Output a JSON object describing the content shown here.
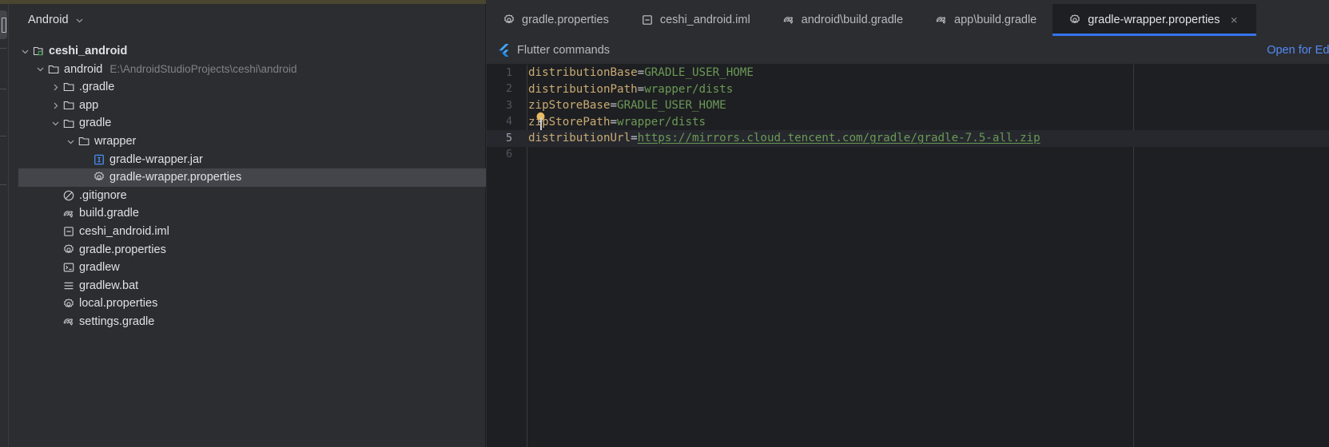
{
  "window": {
    "theme_accent": "#3574f0",
    "background": "#1e1f22",
    "panel_background": "#2b2d30"
  },
  "left_rail": {
    "button_icon": "tool-window-icon"
  },
  "project_panel": {
    "title": "Android",
    "chevron_icon": "chevron-down-icon",
    "tree": [
      {
        "label": "ceshi_android",
        "sub": "",
        "indent": 0,
        "twisty": "expanded",
        "icon": "module-icon",
        "selected": false,
        "bold": true
      },
      {
        "label": "android",
        "sub": "E:\\AndroidStudioProjects\\ceshi\\android",
        "indent": 1,
        "twisty": "expanded",
        "icon": "folder-icon",
        "selected": false,
        "bold": false
      },
      {
        "label": ".gradle",
        "sub": "",
        "indent": 2,
        "twisty": "collapsed",
        "icon": "folder-icon",
        "selected": false,
        "bold": false
      },
      {
        "label": "app",
        "sub": "",
        "indent": 2,
        "twisty": "collapsed",
        "icon": "folder-icon",
        "selected": false,
        "bold": false
      },
      {
        "label": "gradle",
        "sub": "",
        "indent": 2,
        "twisty": "expanded",
        "icon": "folder-icon",
        "selected": false,
        "bold": false
      },
      {
        "label": "wrapper",
        "sub": "",
        "indent": 3,
        "twisty": "expanded",
        "icon": "folder-icon",
        "selected": false,
        "bold": false
      },
      {
        "label": "gradle-wrapper.jar",
        "sub": "",
        "indent": 4,
        "twisty": "none",
        "icon": "jar-icon",
        "selected": false,
        "bold": false
      },
      {
        "label": "gradle-wrapper.properties",
        "sub": "",
        "indent": 4,
        "twisty": "none",
        "icon": "properties-icon",
        "selected": true,
        "bold": false
      },
      {
        "label": ".gitignore",
        "sub": "",
        "indent": 2,
        "twisty": "none",
        "icon": "gitignore-icon",
        "selected": false,
        "bold": false
      },
      {
        "label": "build.gradle",
        "sub": "",
        "indent": 2,
        "twisty": "none",
        "icon": "gradle-icon",
        "selected": false,
        "bold": false
      },
      {
        "label": "ceshi_android.iml",
        "sub": "",
        "indent": 2,
        "twisty": "none",
        "icon": "iml-icon",
        "selected": false,
        "bold": false
      },
      {
        "label": "gradle.properties",
        "sub": "",
        "indent": 2,
        "twisty": "none",
        "icon": "properties-icon",
        "selected": false,
        "bold": false
      },
      {
        "label": "gradlew",
        "sub": "",
        "indent": 2,
        "twisty": "none",
        "icon": "shell-script-icon",
        "selected": false,
        "bold": false
      },
      {
        "label": "gradlew.bat",
        "sub": "",
        "indent": 2,
        "twisty": "none",
        "icon": "text-file-icon",
        "selected": false,
        "bold": false
      },
      {
        "label": "local.properties",
        "sub": "",
        "indent": 2,
        "twisty": "none",
        "icon": "properties-icon",
        "selected": false,
        "bold": false
      },
      {
        "label": "settings.gradle",
        "sub": "",
        "indent": 2,
        "twisty": "none",
        "icon": "gradle-icon",
        "selected": false,
        "bold": false
      }
    ]
  },
  "editor": {
    "tabs": [
      {
        "label": "gradle.properties",
        "icon": "properties-icon",
        "active": false,
        "closable": false
      },
      {
        "label": "ceshi_android.iml",
        "icon": "iml-icon",
        "active": false,
        "closable": false
      },
      {
        "label": "android\\build.gradle",
        "icon": "gradle-icon",
        "active": false,
        "closable": false
      },
      {
        "label": "app\\build.gradle",
        "icon": "gradle-icon",
        "active": false,
        "closable": false
      },
      {
        "label": "gradle-wrapper.properties",
        "icon": "properties-icon",
        "active": true,
        "closable": true
      }
    ],
    "close_icon": "close-icon",
    "banner": {
      "icon": "flutter-icon",
      "label": "Flutter commands",
      "action_label": "Open for Editing",
      "action_color": "#548af7"
    },
    "lines": [
      {
        "number": "1",
        "key": "distributionBase",
        "eq": "=",
        "value": "GRADLE_USER_HOME",
        "link": false,
        "current": false
      },
      {
        "number": "2",
        "key": "distributionPath",
        "eq": "=",
        "value": "wrapper/dists",
        "link": false,
        "current": false
      },
      {
        "number": "3",
        "key": "zipStoreBase",
        "eq": "=",
        "value": "GRADLE_USER_HOME",
        "link": false,
        "current": false
      },
      {
        "number": "4",
        "key": "zipStorePath",
        "eq": "=",
        "value": "wrapper/dists",
        "link": false,
        "current": false
      },
      {
        "number": "5",
        "key": "distributionUrl",
        "eq": "=",
        "value": "https://mirrors.cloud.tencent.com/gradle/gradle-7.5-all.zip",
        "link": true,
        "current": true
      },
      {
        "number": "6",
        "key": "",
        "eq": "",
        "value": "",
        "link": false,
        "current": false
      }
    ],
    "intention_bulb": {
      "icon": "lightbulb-icon",
      "on_line": "4",
      "color": "#e9bb62"
    }
  }
}
